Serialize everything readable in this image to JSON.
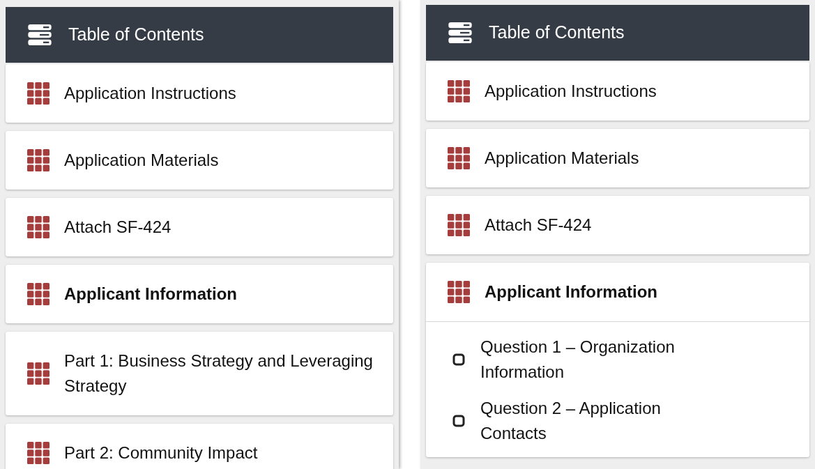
{
  "panels": [
    {
      "title": "Table of Contents",
      "items": [
        {
          "label": "Application Instructions",
          "selected": false,
          "expanded": false
        },
        {
          "label": "Application Materials",
          "selected": false,
          "expanded": false
        },
        {
          "label": "Attach SF-424",
          "selected": false,
          "expanded": false
        },
        {
          "label": "Applicant Information",
          "selected": true,
          "expanded": false
        },
        {
          "label": "Part 1: Business Strategy and Leveraging Strategy",
          "selected": false,
          "expanded": false
        },
        {
          "label": "Part 2: Community Impact",
          "selected": false,
          "expanded": false
        }
      ]
    },
    {
      "title": "Table of Contents",
      "items": [
        {
          "label": "Application Instructions",
          "selected": false,
          "expanded": false
        },
        {
          "label": "Application Materials",
          "selected": false,
          "expanded": false
        },
        {
          "label": "Attach SF-424",
          "selected": false,
          "expanded": false
        },
        {
          "label": "Applicant Information",
          "selected": true,
          "expanded": true,
          "children": [
            {
              "label": "Question 1 – Organization Information"
            },
            {
              "label": "Question 2 – Application Contacts"
            }
          ]
        }
      ]
    }
  ]
}
